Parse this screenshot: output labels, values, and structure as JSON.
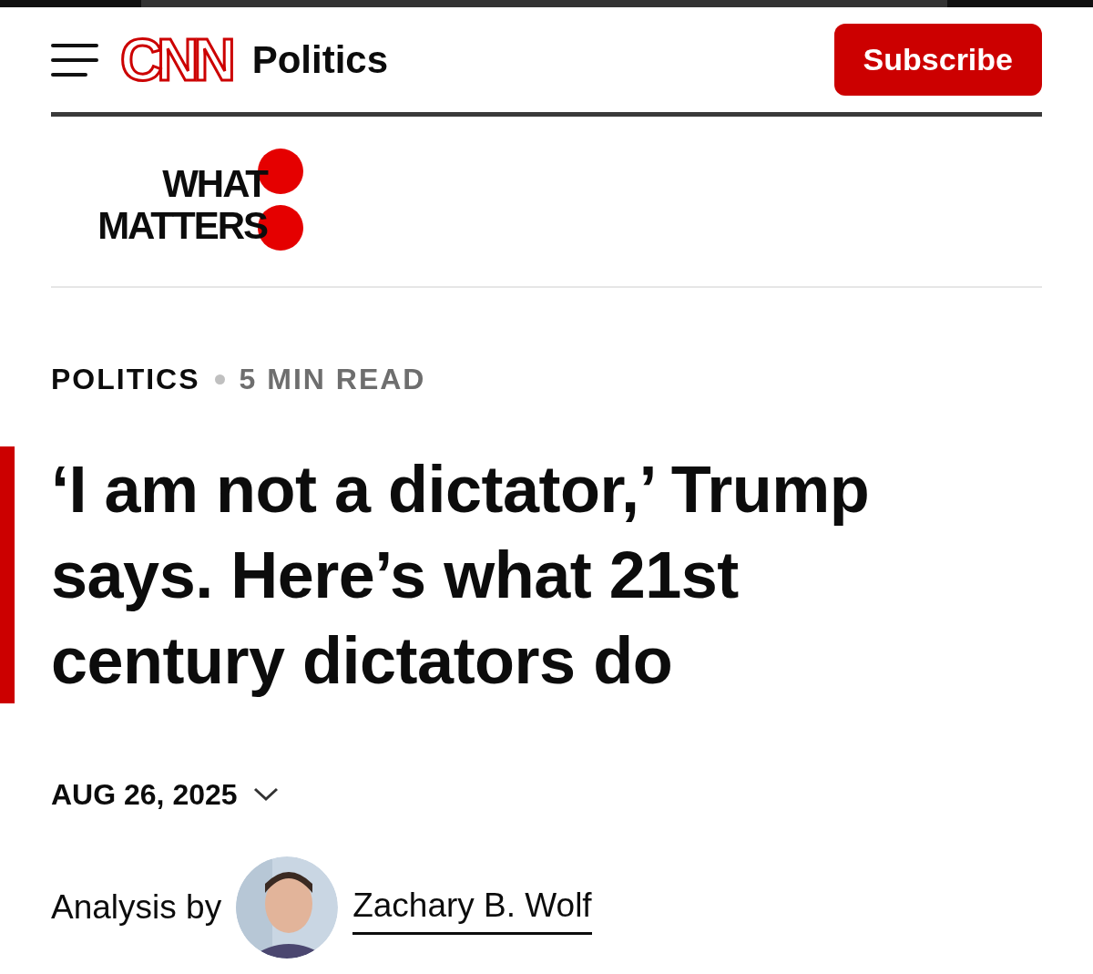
{
  "header": {
    "logo": "CNN",
    "section": "Politics",
    "subscribe": "Subscribe"
  },
  "brand": {
    "line_1": "WHAT",
    "line_2": "MATTERS"
  },
  "meta": {
    "category": "POLITICS",
    "read_time": "5 MIN READ"
  },
  "headline": "‘I am not a dictator,’ Trump says. Here’s what 21st century dictators do",
  "date": {
    "text": "AUG 26, 2025",
    "expanded": false
  },
  "byline": {
    "prefix": "Analysis by",
    "author": "Zachary B. Wolf"
  }
}
